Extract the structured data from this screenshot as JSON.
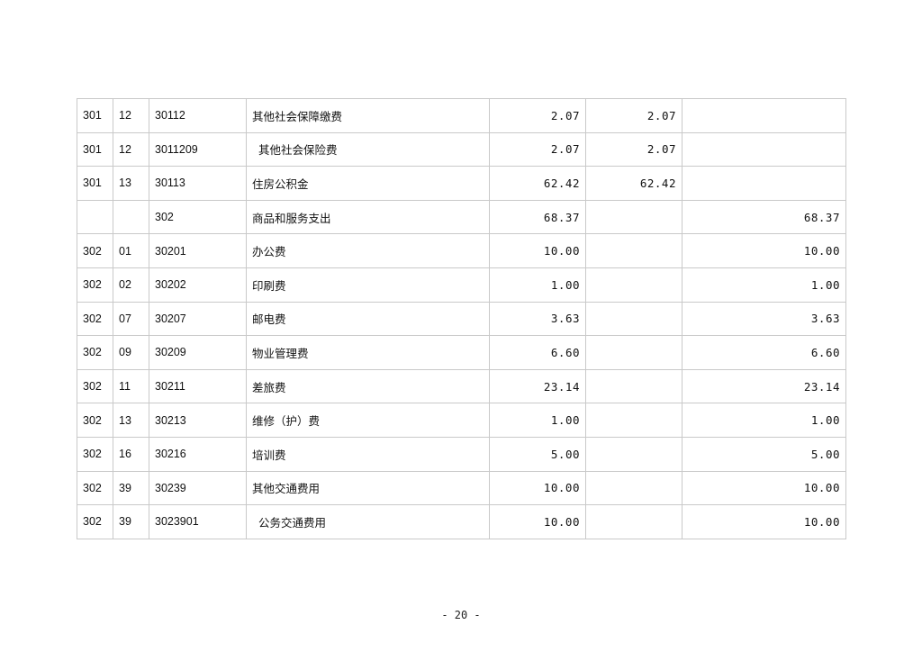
{
  "table": {
    "rows": [
      {
        "cls": "301",
        "kind": "12",
        "code": "30112",
        "name": "其他社会保障缴费",
        "sub": false,
        "total": "2.07",
        "basic": "2.07",
        "project": ""
      },
      {
        "cls": "301",
        "kind": "12",
        "code": "3011209",
        "name": "其他社会保险费",
        "sub": true,
        "total": "2.07",
        "basic": "2.07",
        "project": ""
      },
      {
        "cls": "301",
        "kind": "13",
        "code": "30113",
        "name": "住房公积金",
        "sub": false,
        "total": "62.42",
        "basic": "62.42",
        "project": ""
      },
      {
        "cls": "",
        "kind": "",
        "code": "302",
        "name": "商品和服务支出",
        "sub": false,
        "total": "68.37",
        "basic": "",
        "project": "68.37"
      },
      {
        "cls": "302",
        "kind": "01",
        "code": "30201",
        "name": "办公费",
        "sub": false,
        "total": "10.00",
        "basic": "",
        "project": "10.00"
      },
      {
        "cls": "302",
        "kind": "02",
        "code": "30202",
        "name": "印刷费",
        "sub": false,
        "total": "1.00",
        "basic": "",
        "project": "1.00"
      },
      {
        "cls": "302",
        "kind": "07",
        "code": "30207",
        "name": "邮电费",
        "sub": false,
        "total": "3.63",
        "basic": "",
        "project": "3.63"
      },
      {
        "cls": "302",
        "kind": "09",
        "code": "30209",
        "name": "物业管理费",
        "sub": false,
        "total": "6.60",
        "basic": "",
        "project": "6.60"
      },
      {
        "cls": "302",
        "kind": "11",
        "code": "30211",
        "name": "差旅费",
        "sub": false,
        "total": "23.14",
        "basic": "",
        "project": "23.14"
      },
      {
        "cls": "302",
        "kind": "13",
        "code": "30213",
        "name": "维修（护）费",
        "sub": false,
        "total": "1.00",
        "basic": "",
        "project": "1.00"
      },
      {
        "cls": "302",
        "kind": "16",
        "code": "30216",
        "name": "培训费",
        "sub": false,
        "total": "5.00",
        "basic": "",
        "project": "5.00"
      },
      {
        "cls": "302",
        "kind": "39",
        "code": "30239",
        "name": "其他交通费用",
        "sub": false,
        "total": "10.00",
        "basic": "",
        "project": "10.00"
      },
      {
        "cls": "302",
        "kind": "39",
        "code": "3023901",
        "name": "公务交通费用",
        "sub": true,
        "total": "10.00",
        "basic": "",
        "project": "10.00"
      }
    ]
  },
  "page_number": "- 20 -"
}
